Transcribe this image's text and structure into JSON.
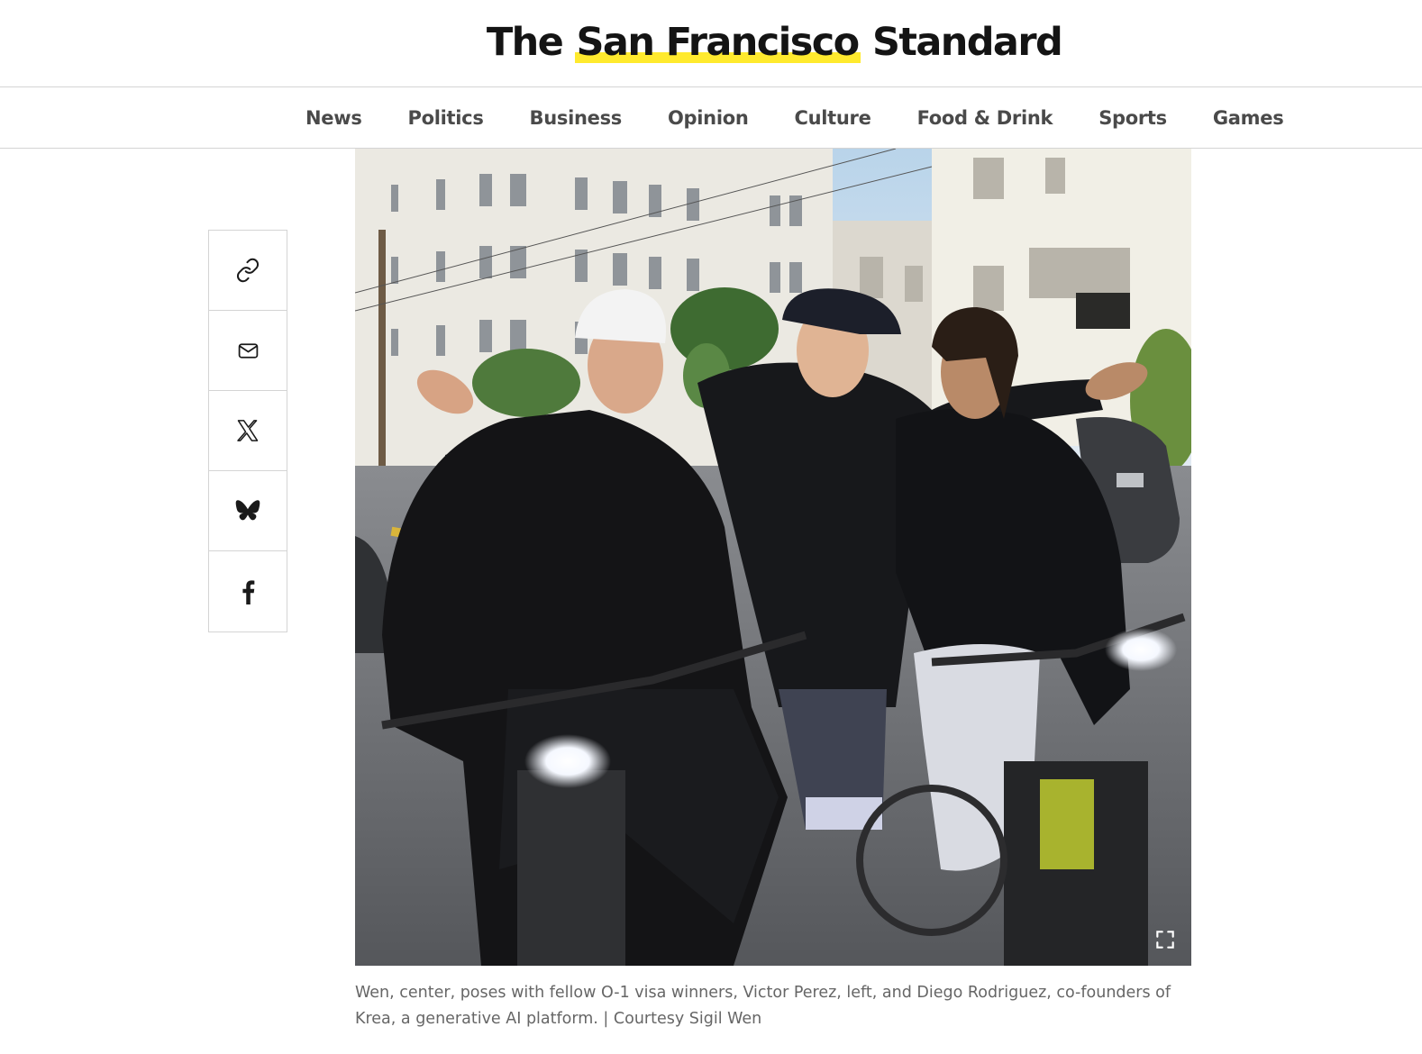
{
  "masthead": {
    "logo_part1": "The",
    "logo_part2": "San Francisco",
    "logo_part3": "Standard"
  },
  "nav": {
    "items": [
      {
        "label": "News"
      },
      {
        "label": "Politics"
      },
      {
        "label": "Business"
      },
      {
        "label": "Opinion"
      },
      {
        "label": "Culture"
      },
      {
        "label": "Food & Drink"
      },
      {
        "label": "Sports"
      },
      {
        "label": "Games"
      }
    ]
  },
  "share": {
    "buttons": [
      {
        "icon": "link-icon"
      },
      {
        "icon": "email-icon"
      },
      {
        "icon": "x-icon"
      },
      {
        "icon": "bluesky-icon"
      },
      {
        "icon": "facebook-icon"
      }
    ]
  },
  "photo": {
    "caption": "Wen, center, poses with fellow O-1 visa winners, Victor Perez, left, and Diego Rodriguez, co-founders of Krea, a generative AI platform. | Courtesy Sigil Wen",
    "expand_icon": "expand-icon"
  },
  "colors": {
    "highlight": "#ffea2e",
    "text": "#141414",
    "nav_text": "#4a4a4a",
    "caption_text": "#666666",
    "border": "#d4d4d4"
  }
}
